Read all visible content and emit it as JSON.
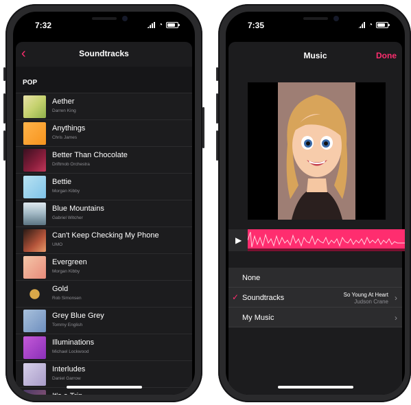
{
  "left": {
    "status": {
      "time": "7:32"
    },
    "nav": {
      "back": "‹",
      "title": "Soundtracks"
    },
    "section": "POP",
    "tracks": [
      {
        "name": "Aether",
        "artist": "Darren King",
        "art": "linear-gradient(135deg,#e8e2a8,#c6d26f 50%,#8fb04a)"
      },
      {
        "name": "Anythings",
        "artist": "Chris James",
        "art": "linear-gradient(135deg,#ffb34a,#f7941d)"
      },
      {
        "name": "Better Than Chocolate",
        "artist": "Driftmob Orchestra",
        "art": "linear-gradient(135deg,#3a1020,#8a1e3c 60%,#c0375a)"
      },
      {
        "name": "Bettie",
        "artist": "Morgan Kibby",
        "art": "linear-gradient(135deg,#b8e2f2,#7fc3e8)"
      },
      {
        "name": "Blue Mountains",
        "artist": "Gabriel Witcher",
        "art": "linear-gradient(180deg,#dfe9ef,#9fb6c2 50%,#5c7482)"
      },
      {
        "name": "Can't Keep Checking My Phone",
        "artist": "UMO",
        "art": "linear-gradient(135deg,#2a1a14,#b4543a 60%,#e89a6a)"
      },
      {
        "name": "Evergreen",
        "artist": "Morgan Kibby",
        "art": "linear-gradient(135deg,#f4c6a8,#e88a7a)"
      },
      {
        "name": "Gold",
        "artist": "Rob Simonsen",
        "art": "radial-gradient(circle,#d9a849 30%,#1c1c1e 32%)"
      },
      {
        "name": "Grey Blue Grey",
        "artist": "Tommy English",
        "art": "linear-gradient(135deg,#a9c1dc,#6e8fbf)"
      },
      {
        "name": "Illuminations",
        "artist": "Michael Lockwood",
        "art": "linear-gradient(135deg,#c45ad8,#8a2fb8)"
      },
      {
        "name": "Interludes",
        "artist": "Daniel Garrow",
        "art": "linear-gradient(135deg,#d7d0ea,#a89bc8)"
      },
      {
        "name": "It's a Trip",
        "artist": "",
        "art": "linear-gradient(135deg,#4b3a66,#9c5a7a)"
      }
    ]
  },
  "right": {
    "status": {
      "time": "7:35"
    },
    "nav": {
      "title": "Music",
      "done": "Done"
    },
    "options": [
      {
        "label": "None",
        "checked": false,
        "detail_title": "",
        "detail_artist": "",
        "chevron": false
      },
      {
        "label": "Soundtracks",
        "checked": true,
        "detail_title": "So Young At Heart",
        "detail_artist": "Judson Crane",
        "chevron": true
      },
      {
        "label": "My Music",
        "checked": false,
        "detail_title": "",
        "detail_artist": "",
        "chevron": true
      }
    ]
  },
  "colors": {
    "accent": "#ff2d6f",
    "background": "#1c1c1e"
  }
}
